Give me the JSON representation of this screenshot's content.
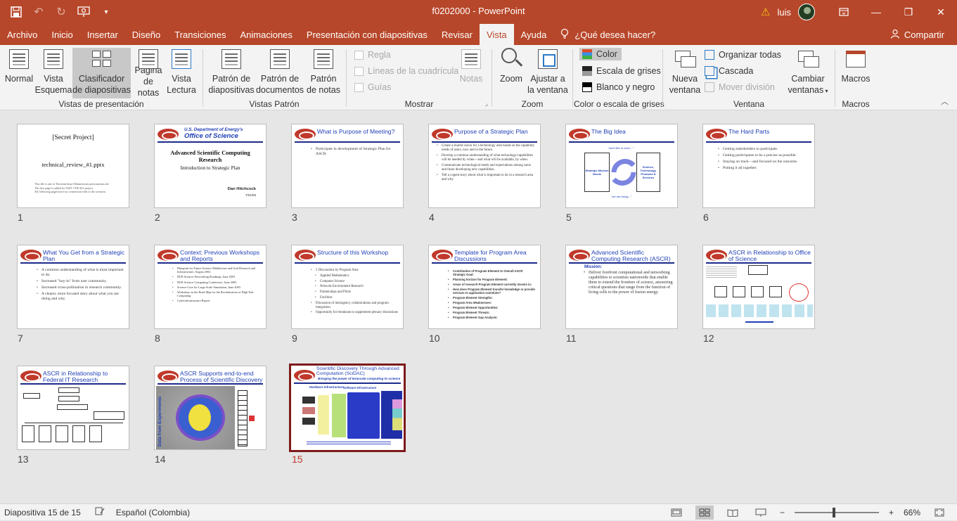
{
  "window": {
    "title": "f0202000 - PowerPoint",
    "user": "luis",
    "qat": {
      "save_icon": "save-icon",
      "undo_icon": "undo-icon",
      "redo_icon": "redo-icon",
      "present_icon": "present-from-start-icon",
      "customize_icon": "chevron-down-icon"
    },
    "controls": {
      "ribbon_display": "ribbon-display-icon",
      "minimize": "—",
      "maximize": "❐",
      "close": "✕"
    }
  },
  "menu": {
    "tabs": [
      "Archivo",
      "Inicio",
      "Insertar",
      "Diseño",
      "Transiciones",
      "Animaciones",
      "Presentación con diapositivas",
      "Revisar",
      "Vista",
      "Ayuda"
    ],
    "active_tab": "Vista",
    "tell_me": "¿Qué desea hacer?",
    "share": "Compartir"
  },
  "ribbon": {
    "presentation_views": {
      "label": "Vistas de presentación",
      "normal": "Normal",
      "outline_1": "Vista",
      "outline_2": "Esquema",
      "sorter_1": "Clasificador",
      "sorter_2": "de diapositivas",
      "notes_1": "Página",
      "notes_2": "de notas",
      "reading_1": "Vista",
      "reading_2": "Lectura"
    },
    "master_views": {
      "label": "Vistas Patrón",
      "slide_1": "Patrón de",
      "slide_2": "diapositivas",
      "handout_1": "Patrón de",
      "handout_2": "documentos",
      "notes_1": "Patrón",
      "notes_2": "de notas"
    },
    "show": {
      "label": "Mostrar",
      "ruler": "Regla",
      "gridlines": "Líneas de la cuadrícula",
      "guides": "Guías",
      "notes": "Notas"
    },
    "zoom": {
      "label": "Zoom",
      "zoom": "Zoom",
      "fit_1": "Ajustar a",
      "fit_2": "la ventana"
    },
    "color": {
      "label": "Color o escala de grises",
      "color": "Color",
      "grayscale": "Escala de grises",
      "bw": "Blanco y negro"
    },
    "window": {
      "label": "Ventana",
      "new_1": "Nueva",
      "new_2": "ventana",
      "arrange": "Organizar todas",
      "cascade": "Cascada",
      "move_split": "Mover división",
      "switch_1": "Cambiar",
      "switch_2": "ventanas"
    },
    "macros": {
      "label": "Macros",
      "macros": "Macros"
    }
  },
  "slides": [
    {
      "num": "1",
      "title": "[Secret Project]",
      "subtitle": "technical_review_#1.pptx",
      "body": [
        "This file is one of Doctiom.http://fbkinernouts.personarasas.do/",
        "The first page is added by NIST CTR-421 project.",
        "All following pages have no connection with to the scenario."
      ]
    },
    {
      "num": "2",
      "header1": "U.S. Department of Energy's",
      "header2": "Office of Science",
      "title": "Advanced Scientific Computing Research",
      "subtitle": "Introduction to Strategic Plan",
      "author": "Dan Hitchcock",
      "date": "7/21/03"
    },
    {
      "num": "3",
      "title": "What is Purpose of Meeting?",
      "bullets": [
        "Participate in development of Strategic Plan for ASCR"
      ]
    },
    {
      "num": "4",
      "title": "Purpose of a Strategic Plan",
      "bullets": [
        "Create a shared vision for a technology area based on the capability needs of users, now and in the future.",
        "Develop a common understanding of what technology/capabilities will be needed by when—and what will be available, by when.",
        "Communicate technological needs and expectations among users and those developing new capabilities.",
        "Tell a cogent story about what is important to do in a research area and why."
      ]
    },
    {
      "num": "5",
      "title": "The Big Idea",
      "top": "\"we'd like to have...\"",
      "left": "Strategic Mission Needs",
      "right": "Science, Technology, Products & Services",
      "bottom": "\"we are doing...\""
    },
    {
      "num": "6",
      "title": "The Hard Parts",
      "bullets": [
        "Getting stakeholders to participate.",
        "Getting participants to be a precise as possible.",
        "Staying on track—and focused on the outcome.",
        "Putting it all together."
      ]
    },
    {
      "num": "7",
      "title": "What You Get from a Strategic Plan",
      "bullets": [
        "A common understanding of what is most important to do.",
        "Increased \"buy-in\" from user community.",
        "Increased cross-pollination in research community.",
        "A clearer, more focused story about what you are doing and why."
      ]
    },
    {
      "num": "8",
      "title": "Context: Previous Workshops and Reports",
      "bullets": [
        "Blueprint for Future Science Middleware and Grid Research and Infrastructure, August 2002",
        "DOE Science Networking Roadmap, June 2003",
        "DOE Science Computing Conference, June 2003",
        "Science Case for Large Scale Simulation, June 2003",
        "Workshop on the Road Map for the Revitalization of High End Computing",
        "Cyberinfrastructure Report"
      ]
    },
    {
      "num": "9",
      "title": "Structure of this Workshop",
      "bullets": [
        "5 Discussions by Program Area",
        "Applied Mathematics",
        "Computer Science",
        "Network Environment Research",
        "Partnerships and Pilots",
        "Facilities",
        "Discussion of interagency collaborations and program integration",
        "Opportunity for breakouts to supplement plenary discussions"
      ]
    },
    {
      "num": "10",
      "title": "Template for Program Area Discussions",
      "bullets": [
        "Contribution of Program Element to Overall ASCR Strategic Goal:",
        "Planning horizon for Program Element:",
        "Areas of research Program Element currently invests in:",
        "How does Program Element transfer knowledge or provide services to application scientists?",
        "Program Element Strengths:",
        "Program Area Weaknesses:",
        "Program Element Opportunities:",
        "Program Element Threats:",
        "Program Element Gap Analysis:"
      ]
    },
    {
      "num": "11",
      "title": "Advanced Scientific Computing Research (ASCR)",
      "mission": "Mission:",
      "bullets": [
        "Deliver forefront computational and networking capabilities to scientists nationwide that enable them to extend the frontiers of science, answering critical questions that range from the function of living cells to the power of fusion energy."
      ]
    },
    {
      "num": "12",
      "title": "ASCR in Relationship to Office of Science"
    },
    {
      "num": "13",
      "title": "ASCR in Relationship to Federal IT Research"
    },
    {
      "num": "14",
      "title": "ASCR Supports end-to-end Process of Scientific Discovery",
      "side": "Data from Experiments"
    },
    {
      "num": "15",
      "title": "Scientific Discovery Through Advanced Computation (SciDAC)",
      "subtitle": "Bringing the power of terascale computing to science",
      "col1": "Hardware Infrastructure",
      "col2": "Software Infrastructure"
    }
  ],
  "selected_slide": "15",
  "status": {
    "slide_info": "Diapositiva 15 de 15",
    "language": "Español (Colombia)",
    "zoom": "66%",
    "zoom_minus": "−",
    "zoom_plus": "+"
  }
}
